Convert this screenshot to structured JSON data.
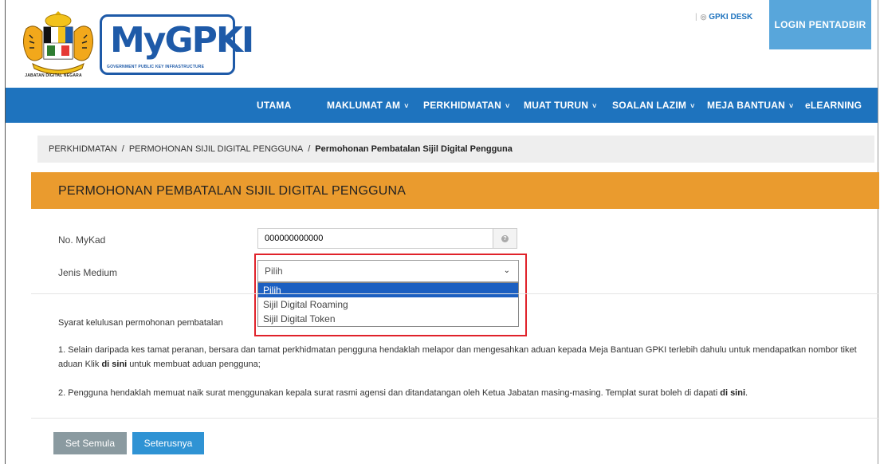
{
  "header": {
    "crest_caption": "JABATAN DIGITAL NEGARA",
    "logo_text": "MyGPKI",
    "logo_subtitle": "GOVERNMENT PUBLIC KEY INFRASTRUCTURE",
    "gpki_desk": "GPKI DESK",
    "login_label": "LOGIN PENTADBIR"
  },
  "nav": {
    "items": [
      {
        "label": "UTAMA",
        "has_dropdown": false
      },
      {
        "label": "MAKLUMAT AM",
        "has_dropdown": true
      },
      {
        "label": "PERKHIDMATAN",
        "has_dropdown": true
      },
      {
        "label": "MUAT TURUN",
        "has_dropdown": true
      },
      {
        "label": "SOALAN LAZIM",
        "has_dropdown": true
      },
      {
        "label": "MEJA BANTUAN",
        "has_dropdown": true
      },
      {
        "label": "eLEARNING",
        "has_dropdown": false
      }
    ],
    "chevron": "˅"
  },
  "breadcrumb": {
    "items": [
      "PERKHIDMATAN",
      "PERMOHONAN SIJIL DIGITAL PENGGUNA",
      "Permohonan Pembatalan Sijil Digital Pengguna"
    ],
    "separator": "/"
  },
  "panel": {
    "title": "PERMOHONAN PEMBATALAN SIJIL DIGITAL PENGGUNA"
  },
  "form": {
    "mykad_label": "No. MyKad",
    "mykad_value": "000000000000",
    "medium_label": "Jenis Medium",
    "medium_selected": "Pilih",
    "medium_options": [
      "Pilih",
      "Sijil Digital Roaming",
      "Sijil Digital Token"
    ]
  },
  "requirements": {
    "heading": "Syarat kelulusan permohonan pembatalan",
    "item1_text": "1. Selain daripada kes tamat peranan, bersara dan tamat perkhidmatan pengguna hendaklah melapor dan mengesahkan aduan kepada Meja Bantuan GPKI terlebih dahulu untuk mendapatkan nombor tiket aduan Klik ",
    "item1_link": "di sini",
    "item1_suffix": " untuk membuat aduan pengguna;",
    "item2_text": "2. Pengguna hendaklah memuat naik surat menggunakan kepala surat rasmi agensi dan ditandatangan oleh Ketua Jabatan masing-masing. Templat surat boleh di dapati ",
    "item2_link": "di sini",
    "item2_suffix": "."
  },
  "buttons": {
    "reset": "Set Semula",
    "next": "Seterusnya"
  },
  "colors": {
    "nav_blue": "#1e73be",
    "panel_orange": "#ea9b2e",
    "highlight_red": "#e0222a",
    "select_blue": "#1b5fc1"
  }
}
